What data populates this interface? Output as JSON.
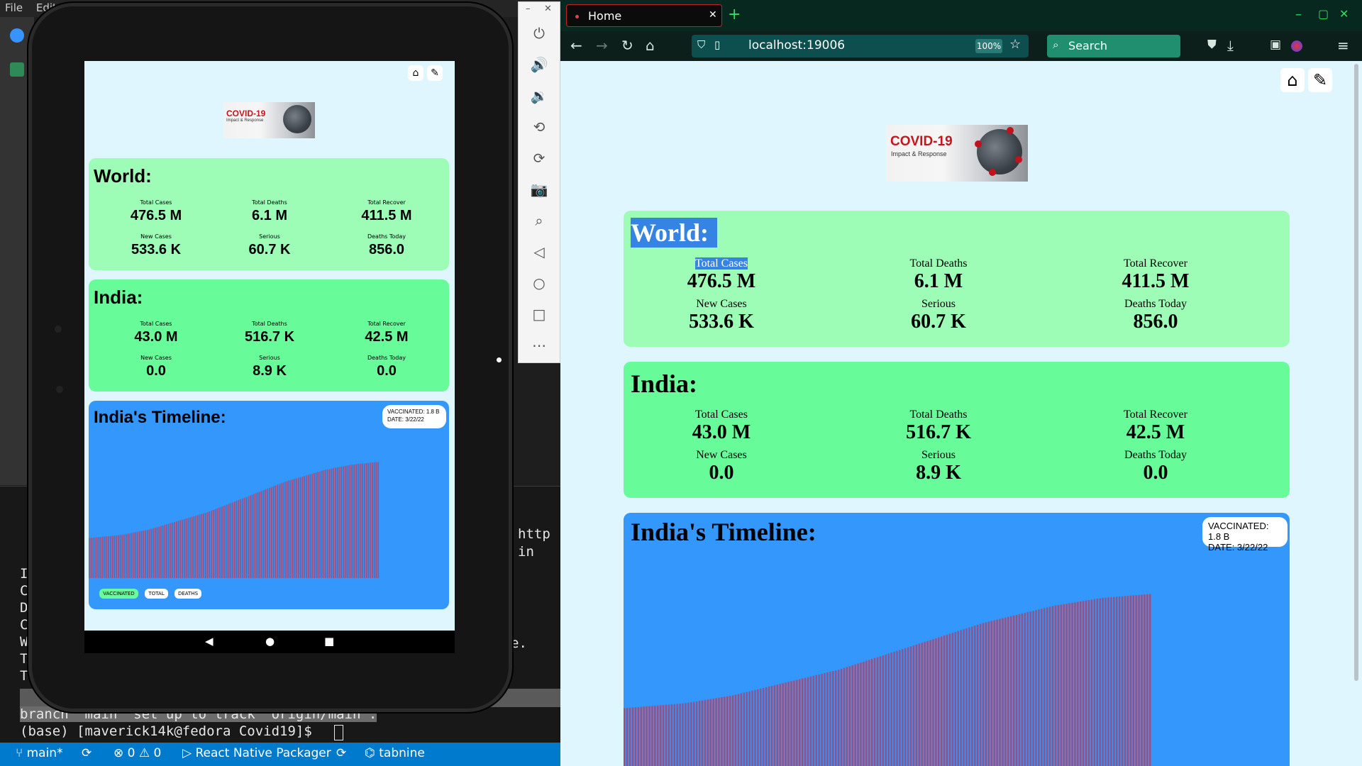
{
  "vscode": {
    "menu": [
      "File",
      "Edit"
    ],
    "terminal_lines": [
      "http",
      "in",
      "I",
      "C",
      "D",
      "C",
      "W",
      "T",
      "T",
      "e.",
      "branch 'main' set up to track 'origin/main'.",
      "(base) [maverick14k@fedora Covid19]$ "
    ],
    "status": {
      "branch": "main*",
      "errors": "0",
      "warnings": "0",
      "packager": "React Native Packager",
      "tabnine": "tabnine"
    }
  },
  "emulator": {
    "toolbar_icons": [
      "power-icon",
      "volume-up-icon",
      "volume-down-icon",
      "rotate-left-icon",
      "rotate-right-icon",
      "camera-icon",
      "zoom-icon",
      "back-icon",
      "home-icon",
      "overview-icon",
      "more-icon"
    ]
  },
  "browser": {
    "tab_title": "Home",
    "url": "localhost:19006",
    "zoom": "100%",
    "search_placeholder": "Search"
  },
  "app": {
    "logo_title": "COVID-19",
    "logo_subtitle": "Impact & Response",
    "world": {
      "title": "World:",
      "stats": [
        {
          "label": "Total Cases",
          "value": "476.5 M"
        },
        {
          "label": "Total Deaths",
          "value": "6.1 M"
        },
        {
          "label": "Total Recover",
          "value": "411.5 M"
        },
        {
          "label": "New Cases",
          "value": "533.6 K"
        },
        {
          "label": "Serious",
          "value": "60.7 K"
        },
        {
          "label": "Deaths Today",
          "value": "856.0"
        }
      ]
    },
    "india": {
      "title": "India:",
      "stats": [
        {
          "label": "Total Cases",
          "value": "43.0 M"
        },
        {
          "label": "Total Deaths",
          "value": "516.7 K"
        },
        {
          "label": "Total Recover",
          "value": "42.5 M"
        },
        {
          "label": "New Cases",
          "value": "0.0"
        },
        {
          "label": "Serious",
          "value": "8.9 K"
        },
        {
          "label": "Deaths Today",
          "value": "0.0"
        }
      ]
    },
    "timeline": {
      "title": "India's Timeline:",
      "tooltip_line1": "VACCINATED: 1.8 B",
      "tooltip_line2": "DATE: 3/22/22",
      "legend": [
        "VACCINATED",
        "TOTAL",
        "DEATHS"
      ]
    },
    "colors": {
      "page_bg": "#e0f6ff",
      "world_card": "#9dfcb5",
      "india_card": "#68fb9a",
      "timeline_card": "#3397fc",
      "bar_fill": "#9b4f7e",
      "selection": "#3584e4"
    }
  },
  "chart_data": {
    "type": "bar",
    "title": "India's Timeline:",
    "series": [
      {
        "name": "VACCINATED",
        "values": [
          0.62,
          0.63,
          0.64,
          0.65,
          0.66,
          0.67,
          0.69,
          0.71,
          0.73,
          0.75,
          0.78,
          0.81,
          0.84,
          0.87,
          0.9,
          0.93,
          0.96,
          0.99,
          1.02,
          1.06,
          1.1,
          1.14,
          1.18,
          1.22,
          1.26,
          1.3,
          1.34,
          1.38,
          1.42,
          1.46,
          1.5,
          1.53,
          1.56,
          1.59,
          1.62,
          1.65,
          1.68,
          1.7,
          1.72,
          1.74,
          1.76,
          1.77,
          1.78,
          1.79,
          1.8
        ]
      }
    ],
    "ylim": [
      0,
      2.2
    ]
  }
}
